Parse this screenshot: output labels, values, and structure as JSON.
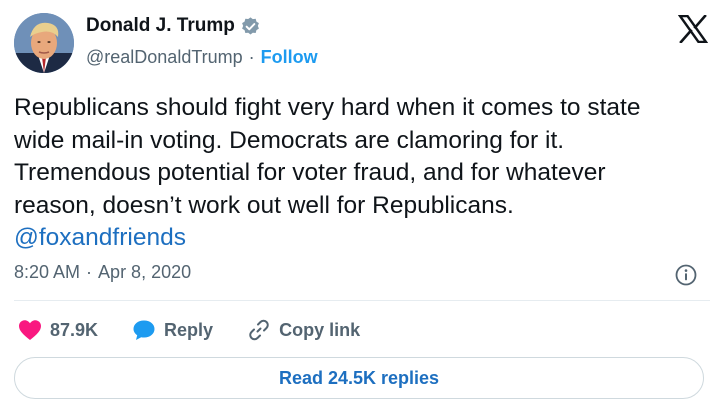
{
  "author": {
    "name": "Donald J. Trump",
    "handle": "@realDonaldTrump",
    "separator": "·",
    "follow_label": "Follow",
    "verified": true
  },
  "tweet": {
    "text": "Republicans should fight very hard when it comes to state\nwide mail-in voting. Democrats are clamoring for it.\nTremendous potential for voter fraud, and for whatever\nreason,  doesn’t work out well for Republicans.",
    "mention": "@foxandfriends",
    "time": "8:20 AM",
    "separator": "·",
    "date": "Apr 8, 2020"
  },
  "actions": {
    "likes_count": "87.9K",
    "reply_label": "Reply",
    "copy_link_label": "Copy link"
  },
  "read_replies_label": "Read 24.5K replies",
  "icons": {
    "brand": "x-logo-icon",
    "verified": "verified-badge-icon",
    "like": "heart-icon",
    "reply": "speech-bubble-icon",
    "copy": "link-icon",
    "info": "info-icon"
  },
  "colors": {
    "accent": "#1d9bf0",
    "link": "#1d6fc0",
    "like": "#f91880",
    "text": "#0f1419",
    "muted": "#536471"
  }
}
